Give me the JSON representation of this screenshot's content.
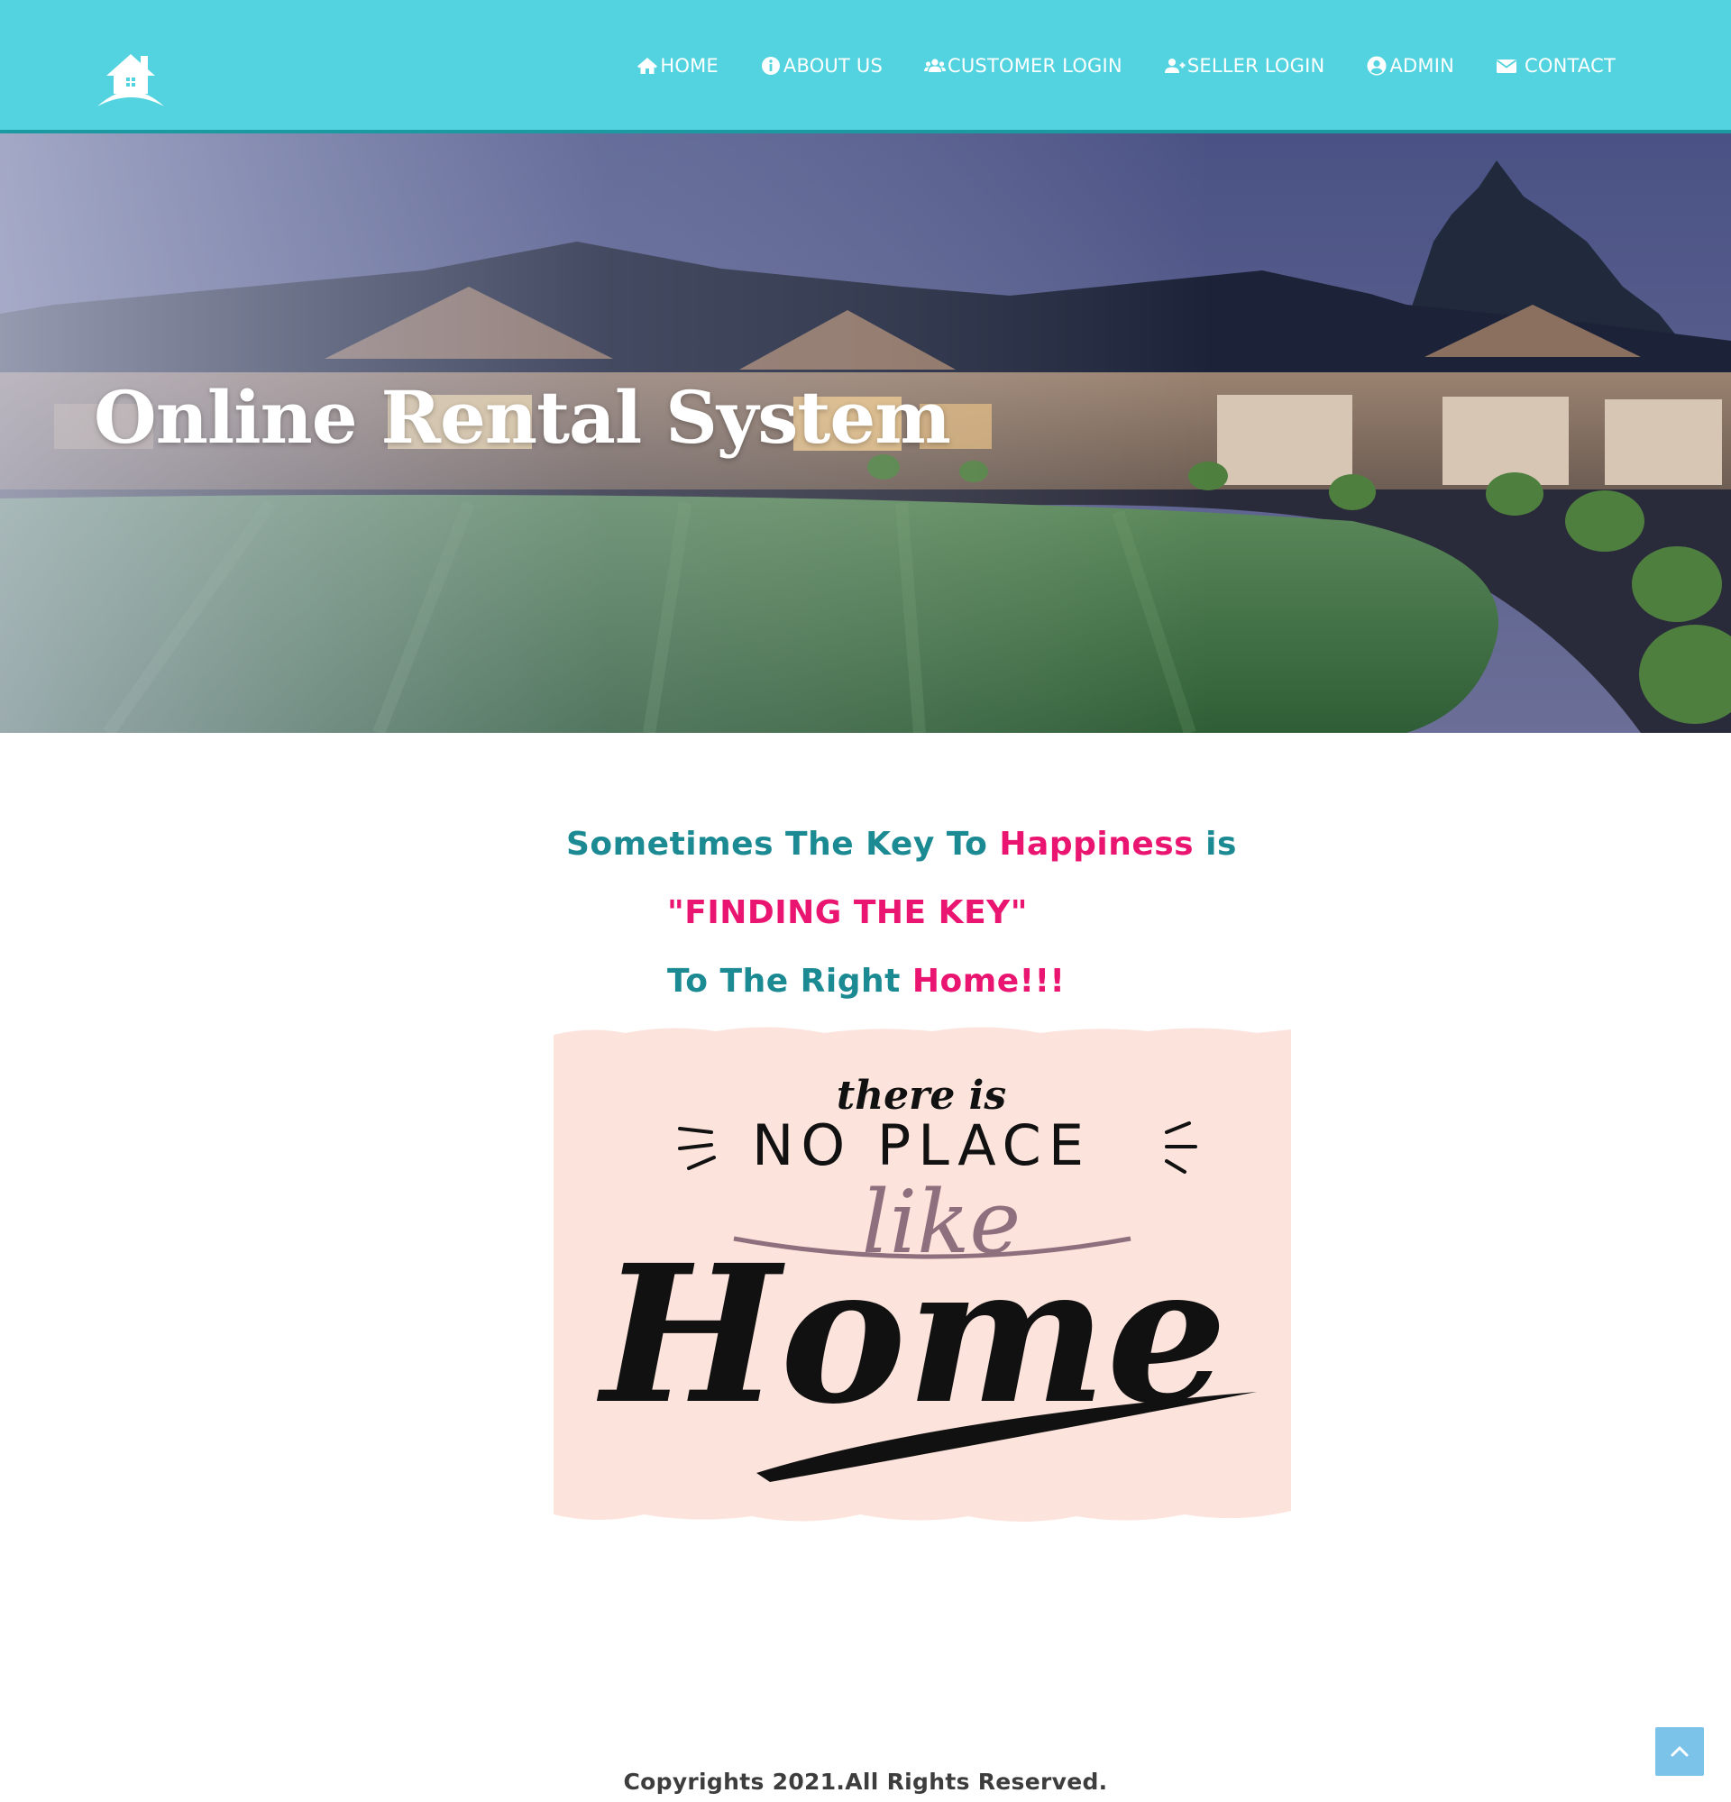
{
  "header": {
    "logo_icon": "house-logo-icon",
    "nav": [
      {
        "label": "HOME",
        "icon": "home-icon"
      },
      {
        "label": "ABOUT US",
        "icon": "info-circle-icon"
      },
      {
        "label": "CUSTOMER LOGIN",
        "icon": "users-icon"
      },
      {
        "label": "SELLER LOGIN",
        "icon": "user-plus-icon"
      },
      {
        "label": "ADMIN",
        "icon": "user-circle-icon"
      },
      {
        "label": "CONTACT",
        "icon": "envelope-icon"
      }
    ]
  },
  "hero": {
    "title": "Online Rental System"
  },
  "quote": {
    "line1_a": "Sometimes The Key To ",
    "line1_b": "Happiness",
    "line1_c": " is",
    "line2": "\"FINDING THE KEY\"",
    "line3_a": "To The Right ",
    "line3_b": "Home!!!"
  },
  "poster": {
    "text_top": "there is",
    "text_middle": "NO PLACE",
    "text_script": "like",
    "text_main": "Home"
  },
  "footer": {
    "copyright": "Copyrights 2021.All Rights Reserved."
  },
  "colors": {
    "header_bg": "#52d3df",
    "teal_text": "#1b8a92",
    "pink_text": "#ea1570",
    "to_top_bg": "#7cc3ea",
    "poster_bg": "#fce3dc"
  }
}
